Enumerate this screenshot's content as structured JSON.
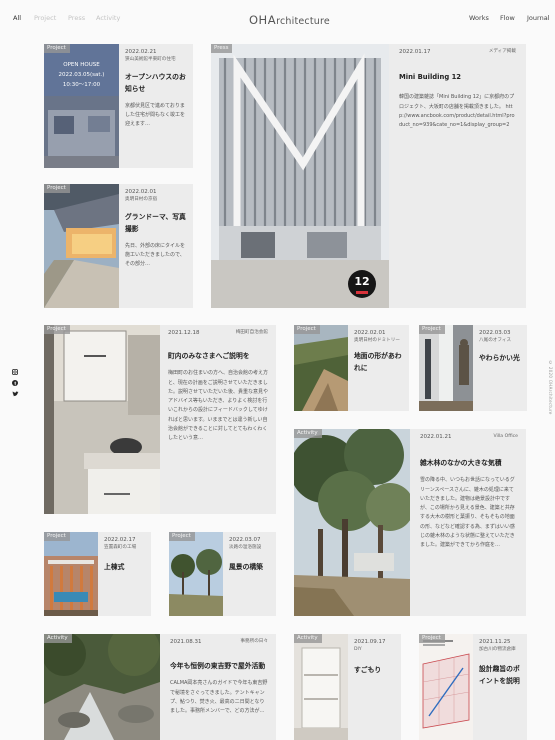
{
  "filters": [
    "All",
    "Project",
    "Press",
    "Activity"
  ],
  "logo": {
    "big": "OHA",
    "rest": "rchitecture"
  },
  "menu": [
    "Works",
    "Flow",
    "Journal"
  ],
  "copyright": "© 2020 OHArchitecture",
  "social": [
    "instagram-icon",
    "facebook-icon",
    "twitter-icon"
  ],
  "posts": [
    {
      "tag": "Project",
      "date": "2022.02.21",
      "place": "狭山美術館半東町の住宅",
      "title": "オープンハウスのお知らせ",
      "text": "京都伏見区で進めておりました住宅が間もなく竣工を迎えます…",
      "overlay": [
        "OPEN HOUSE",
        "2022.03.05(sat.)",
        "10:30～17:00"
      ]
    },
    {
      "tag": "Project",
      "date": "2022.02.01",
      "place": "奥明日村の京宿",
      "title": "グランドーマ、写真撮影",
      "text": "先日、外部の床にタイルを施工いただきましたので、その部分…"
    },
    {
      "tag": "Press",
      "date": "2022.01.17",
      "place": "メディア掲載",
      "title": "Mini Building 12",
      "text": "韓国の建築雑誌「Mini Building 12」に京都府のプロジェクト、大坂町の店舗を掲載頂きました。 http://www.ancbook.com/product/detail.html?product_no=939&cate_no=1&display_group=2",
      "badge": "12"
    },
    {
      "tag": "Project",
      "date": "2021.12.18",
      "place": "梅田町自治会館",
      "title": "町内のみなさまへご説明を",
      "text": "梅田町のお住まいの方へ、自治会館の考え方と、現在の計画をご説明させていただきました。説明させていただいた後、貴重な意見やアドバイス等もいただき、よりよく検討を行いこれからの設計にフィードバックしてゆければと思います。いままでとは違う新しい自治会館ができることに対してとてもわくわくしたという意…"
    },
    {
      "tag": "Project",
      "date": "2022.02.01",
      "place": "奥明日村のドミトリー",
      "title": "地面の形があわれに",
      "text": ""
    },
    {
      "tag": "Project",
      "date": "2022.03.03",
      "place": "八尾のオフィス",
      "title": "やわらかい光",
      "text": ""
    },
    {
      "tag": "Activity",
      "date": "2022.01.21",
      "place": "Villa Office",
      "title": "雑木林のなかの大きな気積",
      "text": "雪の降る中、いつもお世話になっているグリーンスペースさんに、雑木の処理に来ていただきました。建物は絶景設計中ですが、この場所から見える景色、建築と共存する大木の樹形と葉振り、そもそもの地面の形、などなど確認する為、まずはいい感じの雑木林のような状態に整えていただきました。建築ができてから作庭を…"
    },
    {
      "tag": "Project",
      "date": "2022.02.17",
      "place": "笠置森町の工場",
      "title": "上棟式",
      "text": ""
    },
    {
      "tag": "Project",
      "date": "2022.03.07",
      "place": "淡路の温浴施設",
      "title": "風景の構築",
      "text": ""
    },
    {
      "tag": "Activity",
      "date": "2021.08.31",
      "place": "事務所の日々",
      "title": "今年も恒例の東吉野で屋外活動",
      "text": "CALMA岡本亮さんのガイドで今年も東吉野で秘境をさぐってきました。テントキャンプ、鮎つり、焚き火、最高の二日間となりました。事務所メンバーで、どの方法が…"
    },
    {
      "tag": "Activity",
      "date": "2021.09.17",
      "place": "DIY",
      "title": "すごもり",
      "text": ""
    },
    {
      "tag": "Project",
      "date": "2021.11.25",
      "place": "加古川の物流倉庫",
      "title": "設計趣旨のポイントを説明",
      "text": ""
    }
  ]
}
